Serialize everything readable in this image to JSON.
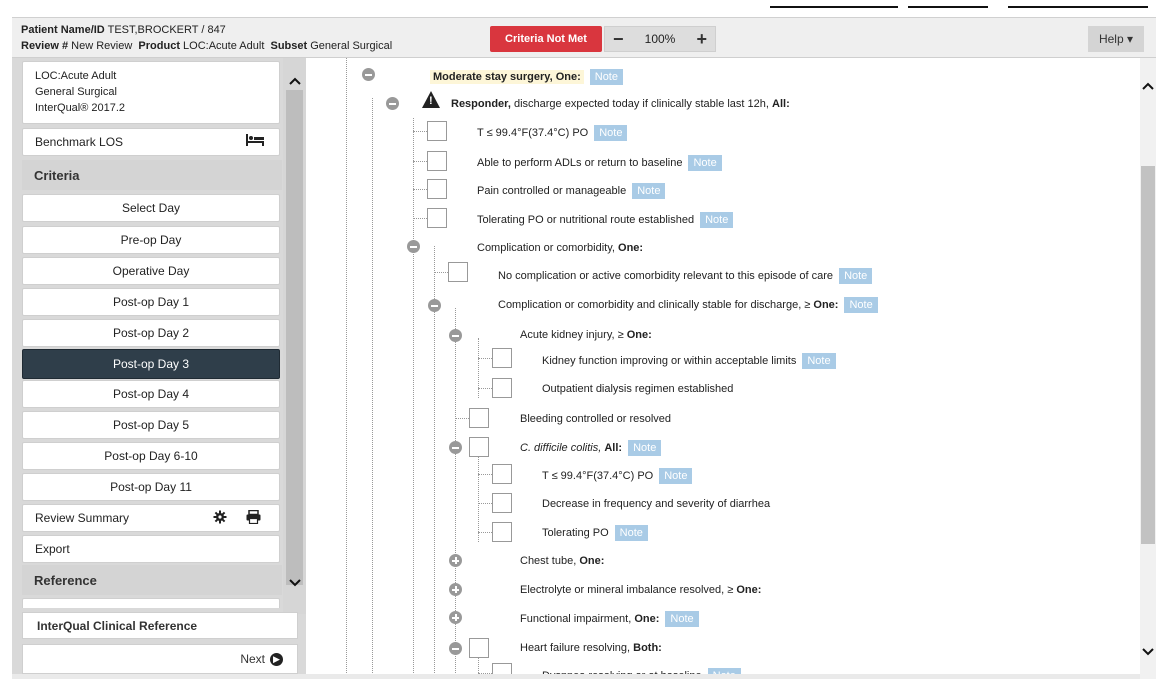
{
  "header": {
    "patient_label": "Patient Name/ID",
    "patient_value": "TEST,BROCKERT / 847",
    "review_label": "Review #",
    "review_value": "New Review",
    "product_label": "Product",
    "product_value": "LOC:Acute Adult",
    "subset_label": "Subset",
    "subset_value": "General Surgical",
    "criteria_status": "Criteria Not Met",
    "zoom_minus": "−",
    "zoom_value": "100%",
    "zoom_plus": "+",
    "help_label": "Help ▾"
  },
  "sidebar": {
    "library": [
      "LOC:Acute Adult",
      "General Surgical",
      "InterQual® 2017.2"
    ],
    "benchmark": "Benchmark LOS",
    "criteria_heading": "Criteria",
    "select_day": "Select Day",
    "days": [
      "Pre-op Day",
      "Operative Day",
      "Post-op Day 1",
      "Post-op Day 2",
      "Post-op Day 3",
      "Post-op Day 4",
      "Post-op Day 5",
      "Post-op Day 6-10",
      "Post-op Day 11"
    ],
    "active_day": "Post-op Day 3",
    "review_summary": "Review Summary",
    "export": "Export",
    "reference_heading": "Reference",
    "clinical_reference": "InterQual Clinical Reference",
    "next": "Next"
  },
  "tree": {
    "note": "Note",
    "n1_a": "Moderate stay surgery,",
    "n1_b": "One:",
    "n2_a": "Responder,",
    "n2_b": "discharge expected today if clinically stable last 12h,",
    "n2_c": "All:",
    "i1": "T ≤ 99.4°F(37.4°C) PO",
    "i2": "Able to perform ADLs or return to baseline",
    "i3": "Pain controlled or manageable",
    "i4": "Tolerating PO or nutritional route established",
    "i5_a": "Complication or comorbidity,",
    "i5_b": "One:",
    "i6": "No complication or active comorbidity relevant to this episode of care",
    "i7_a": "Complication or comorbidity and clinically stable for discharge, ≥",
    "i7_b": "One:",
    "i8_a": "Acute kidney injury, ≥",
    "i8_b": "One:",
    "i9": "Kidney function improving or within acceptable limits",
    "i10": "Outpatient dialysis regimen established",
    "i11": "Bleeding controlled or resolved",
    "i12_a": "C. difficile colitis,",
    "i12_b": "All:",
    "i13": "T ≤ 99.4°F(37.4°C) PO",
    "i14": "Decrease in frequency and severity of diarrhea",
    "i15": "Tolerating PO",
    "i16_a": "Chest tube,",
    "i16_b": "One:",
    "i17_a": "Electrolyte or mineral imbalance resolved, ≥",
    "i17_b": "One:",
    "i18_a": "Functional impairment,",
    "i18_b": "One:",
    "i19_a": "Heart failure resolving,",
    "i19_b": "Both:",
    "i20": "Dyspnea resolving or at baseline"
  }
}
